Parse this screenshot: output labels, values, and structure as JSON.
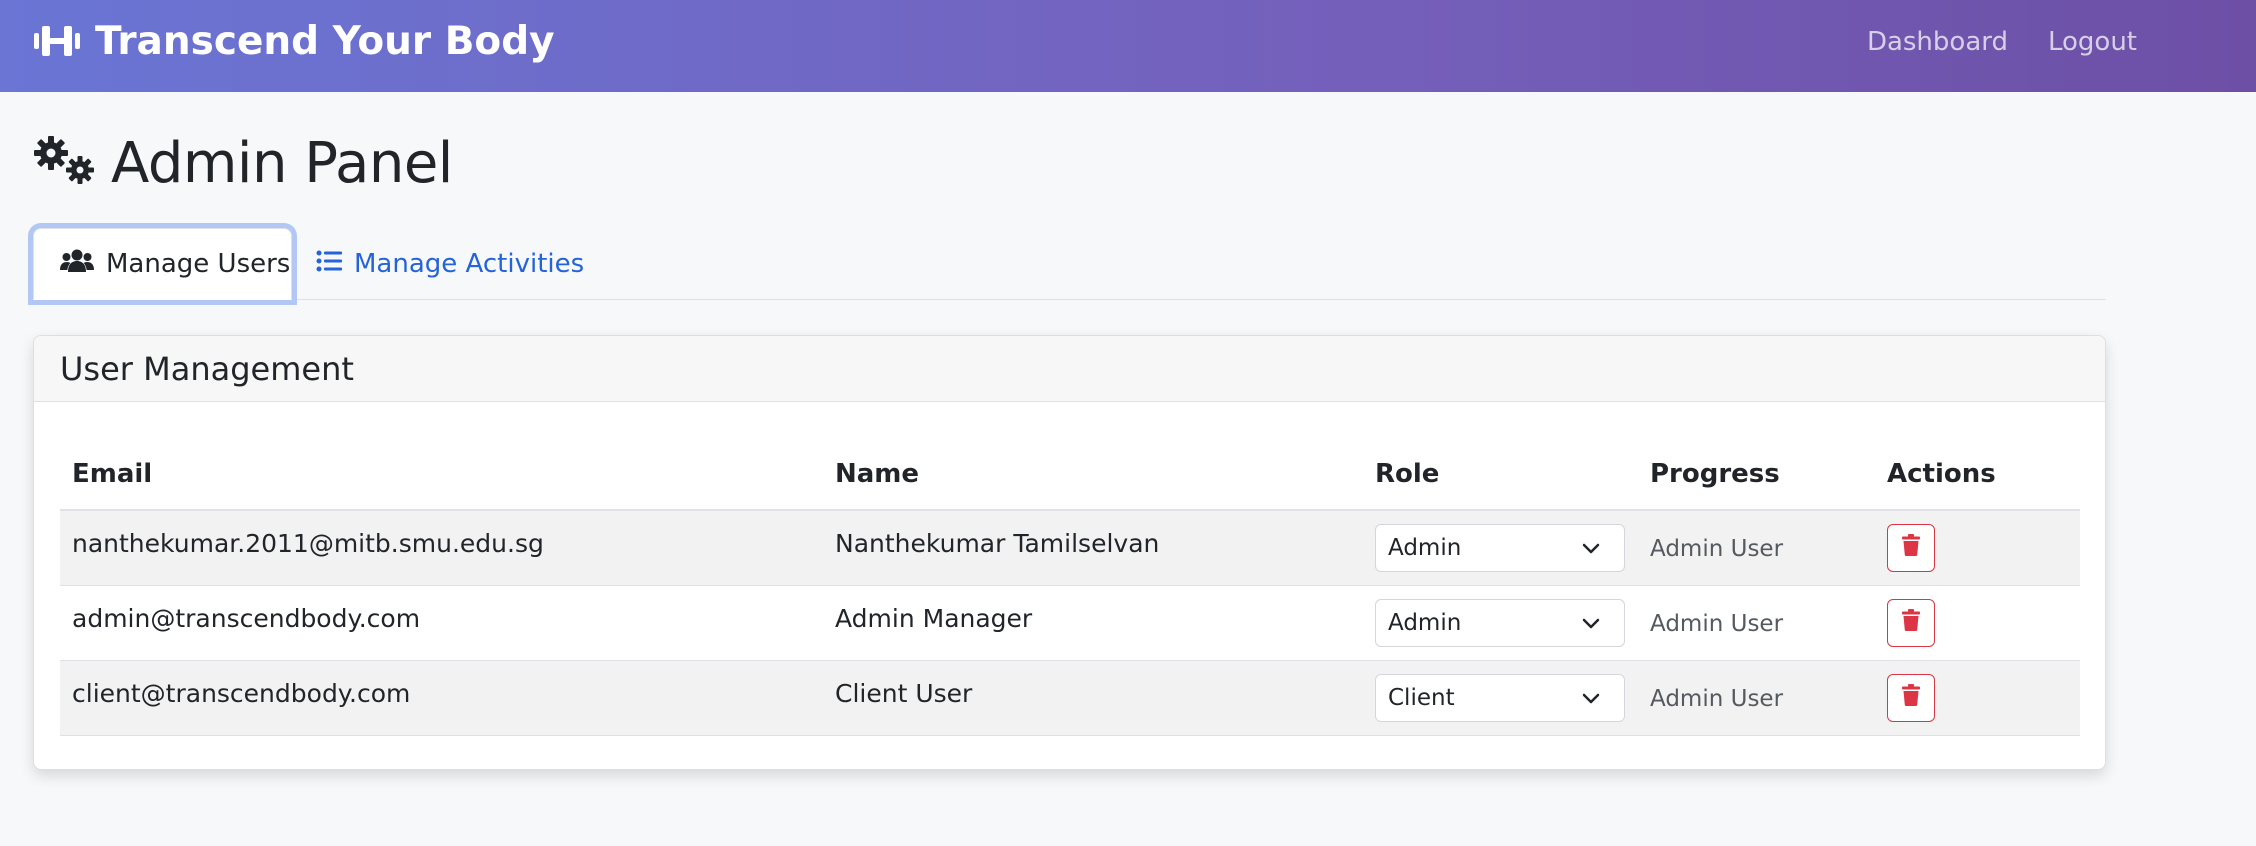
{
  "navbar": {
    "brand": "Transcend Your Body",
    "brand_icon": "dumbbell-icon",
    "links": [
      "Dashboard",
      "Logout"
    ]
  },
  "page": {
    "title": "Admin Panel",
    "title_icon": "gears-icon"
  },
  "tabs": [
    {
      "label": "Manage Users",
      "icon": "users-icon",
      "active": true
    },
    {
      "label": "Manage Activities",
      "icon": "list-icon",
      "active": false
    }
  ],
  "card": {
    "title": "User Management"
  },
  "table": {
    "columns": [
      "Email",
      "Name",
      "Role",
      "Progress",
      "Actions"
    ],
    "rows": [
      {
        "email": "nanthekumar.2011@mitb.smu.edu.sg",
        "name": "Nanthekumar Tamilselvan",
        "role": "Admin",
        "progress": "Admin User"
      },
      {
        "email": "admin@transcendbody.com",
        "name": "Admin Manager",
        "role": "Admin",
        "progress": "Admin User"
      },
      {
        "email": "client@transcendbody.com",
        "name": "Client User",
        "role": "Client",
        "progress": "Admin User"
      }
    ]
  },
  "colors": {
    "accent_link": "#2563d8",
    "danger": "#dc3545",
    "navbar_start": "#6a75d4",
    "navbar_end": "#6d4fa6"
  }
}
